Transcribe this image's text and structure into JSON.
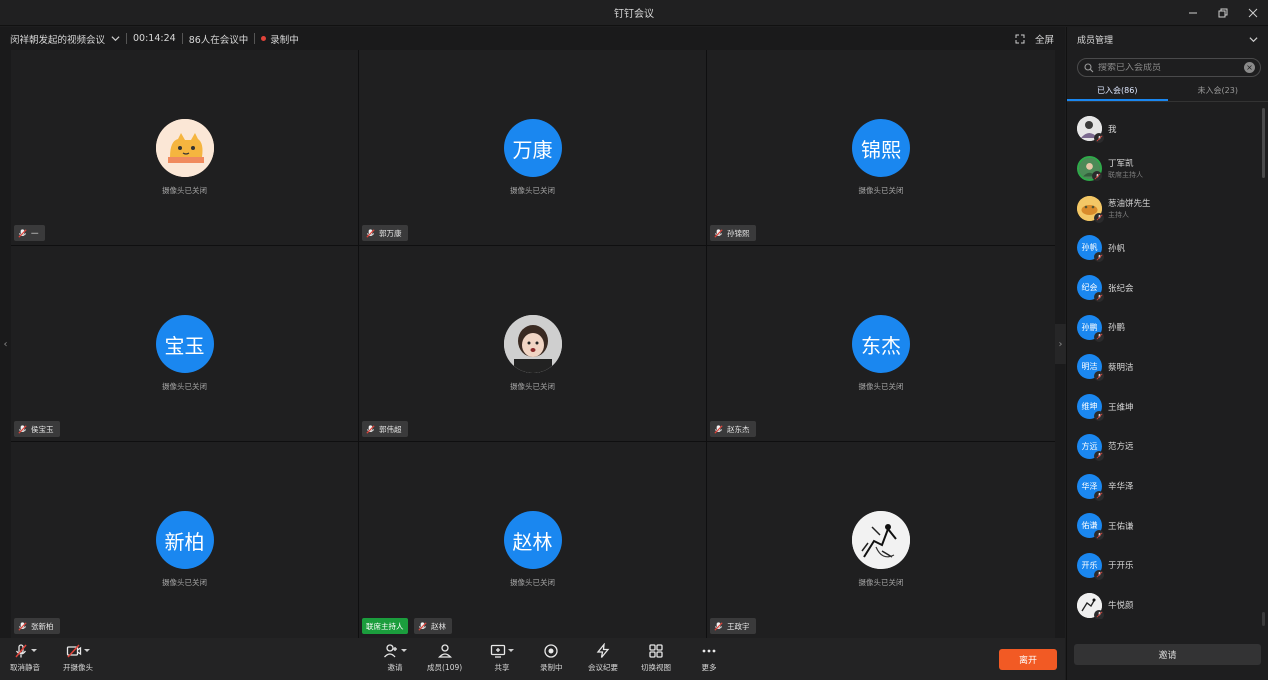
{
  "window": {
    "title": "钉钉会议"
  },
  "infobar": {
    "meeting_name": "闵祥朝发起的视频会议",
    "duration": "00:14:24",
    "participants": "86人在会议中",
    "recording": "录制中",
    "fullscreen": "全屏",
    "recording_color": "#e0433a"
  },
  "tiles": [
    {
      "avatar": "cat-sticker-avatar",
      "cam_status": "摄像头已关闭",
      "name": "一"
    },
    {
      "avatar_text": "万康",
      "cam_status": "摄像头已关闭",
      "name": "郭万康"
    },
    {
      "avatar_text": "锦熙",
      "cam_status": "摄像头已关闭",
      "name": "孙锦熙"
    },
    {
      "avatar_text": "宝玉",
      "cam_status": "摄像头已关闭",
      "name": "侯宝玉"
    },
    {
      "avatar": "child-photo-avatar",
      "cam_status": "摄像头已关闭",
      "name": "郭伟超"
    },
    {
      "avatar_text": "东杰",
      "cam_status": "摄像头已关闭",
      "name": "赵东杰"
    },
    {
      "avatar_text": "新柏",
      "cam_status": "摄像头已关闭",
      "name": "张新柏"
    },
    {
      "avatar_text": "赵林",
      "cam_status": "摄像头已关闭",
      "name": "赵林",
      "host_badge": "联席主持人"
    },
    {
      "avatar": "sketch-art-avatar",
      "cam_status": "摄像头已关闭",
      "name": "王政宇"
    }
  ],
  "toolbar": {
    "mute": "取消静音",
    "camera": "开摄像头",
    "invite": "邀请",
    "members": "成员(109)",
    "share": "共享",
    "record": "录制中",
    "minutes": "会议纪要",
    "switch_view": "切换视图",
    "more": "更多",
    "leave": "离开",
    "leave_color": "#f25a24"
  },
  "panel": {
    "title": "成员管理",
    "search_placeholder": "搜索已入会成员",
    "tab_joined": "已入会(86)",
    "tab_not_joined": "未入会(23)",
    "invite": "邀请",
    "members": [
      {
        "avatar": "photo-avatar",
        "name": "我",
        "role": ""
      },
      {
        "avatar": "green-photo-avatar",
        "name": "丁军凯",
        "role": "联席主持人"
      },
      {
        "avatar": "yellow-photo-avatar",
        "name": "葱油饼先生",
        "role": "主持人"
      },
      {
        "avatar_text": "孙帆",
        "name": "孙帆",
        "role": ""
      },
      {
        "avatar_text": "纪会",
        "name": "张纪会",
        "role": ""
      },
      {
        "avatar_text": "孙鹏",
        "name": "孙鹏",
        "role": ""
      },
      {
        "avatar_text": "明洁",
        "name": "蔡明洁",
        "role": ""
      },
      {
        "avatar_text": "维坤",
        "name": "王维坤",
        "role": ""
      },
      {
        "avatar_text": "方远",
        "name": "范方远",
        "role": ""
      },
      {
        "avatar_text": "华泽",
        "name": "辛华泽",
        "role": ""
      },
      {
        "avatar_text": "佑谦",
        "name": "王佑谦",
        "role": ""
      },
      {
        "avatar_text": "开乐",
        "name": "于开乐",
        "role": ""
      },
      {
        "avatar": "sketch-photo-avatar",
        "name": "牛悦颜",
        "role": ""
      }
    ]
  },
  "colors": {
    "avatar_blue": "#1a87f0",
    "host_green": "#1b9d3d"
  }
}
